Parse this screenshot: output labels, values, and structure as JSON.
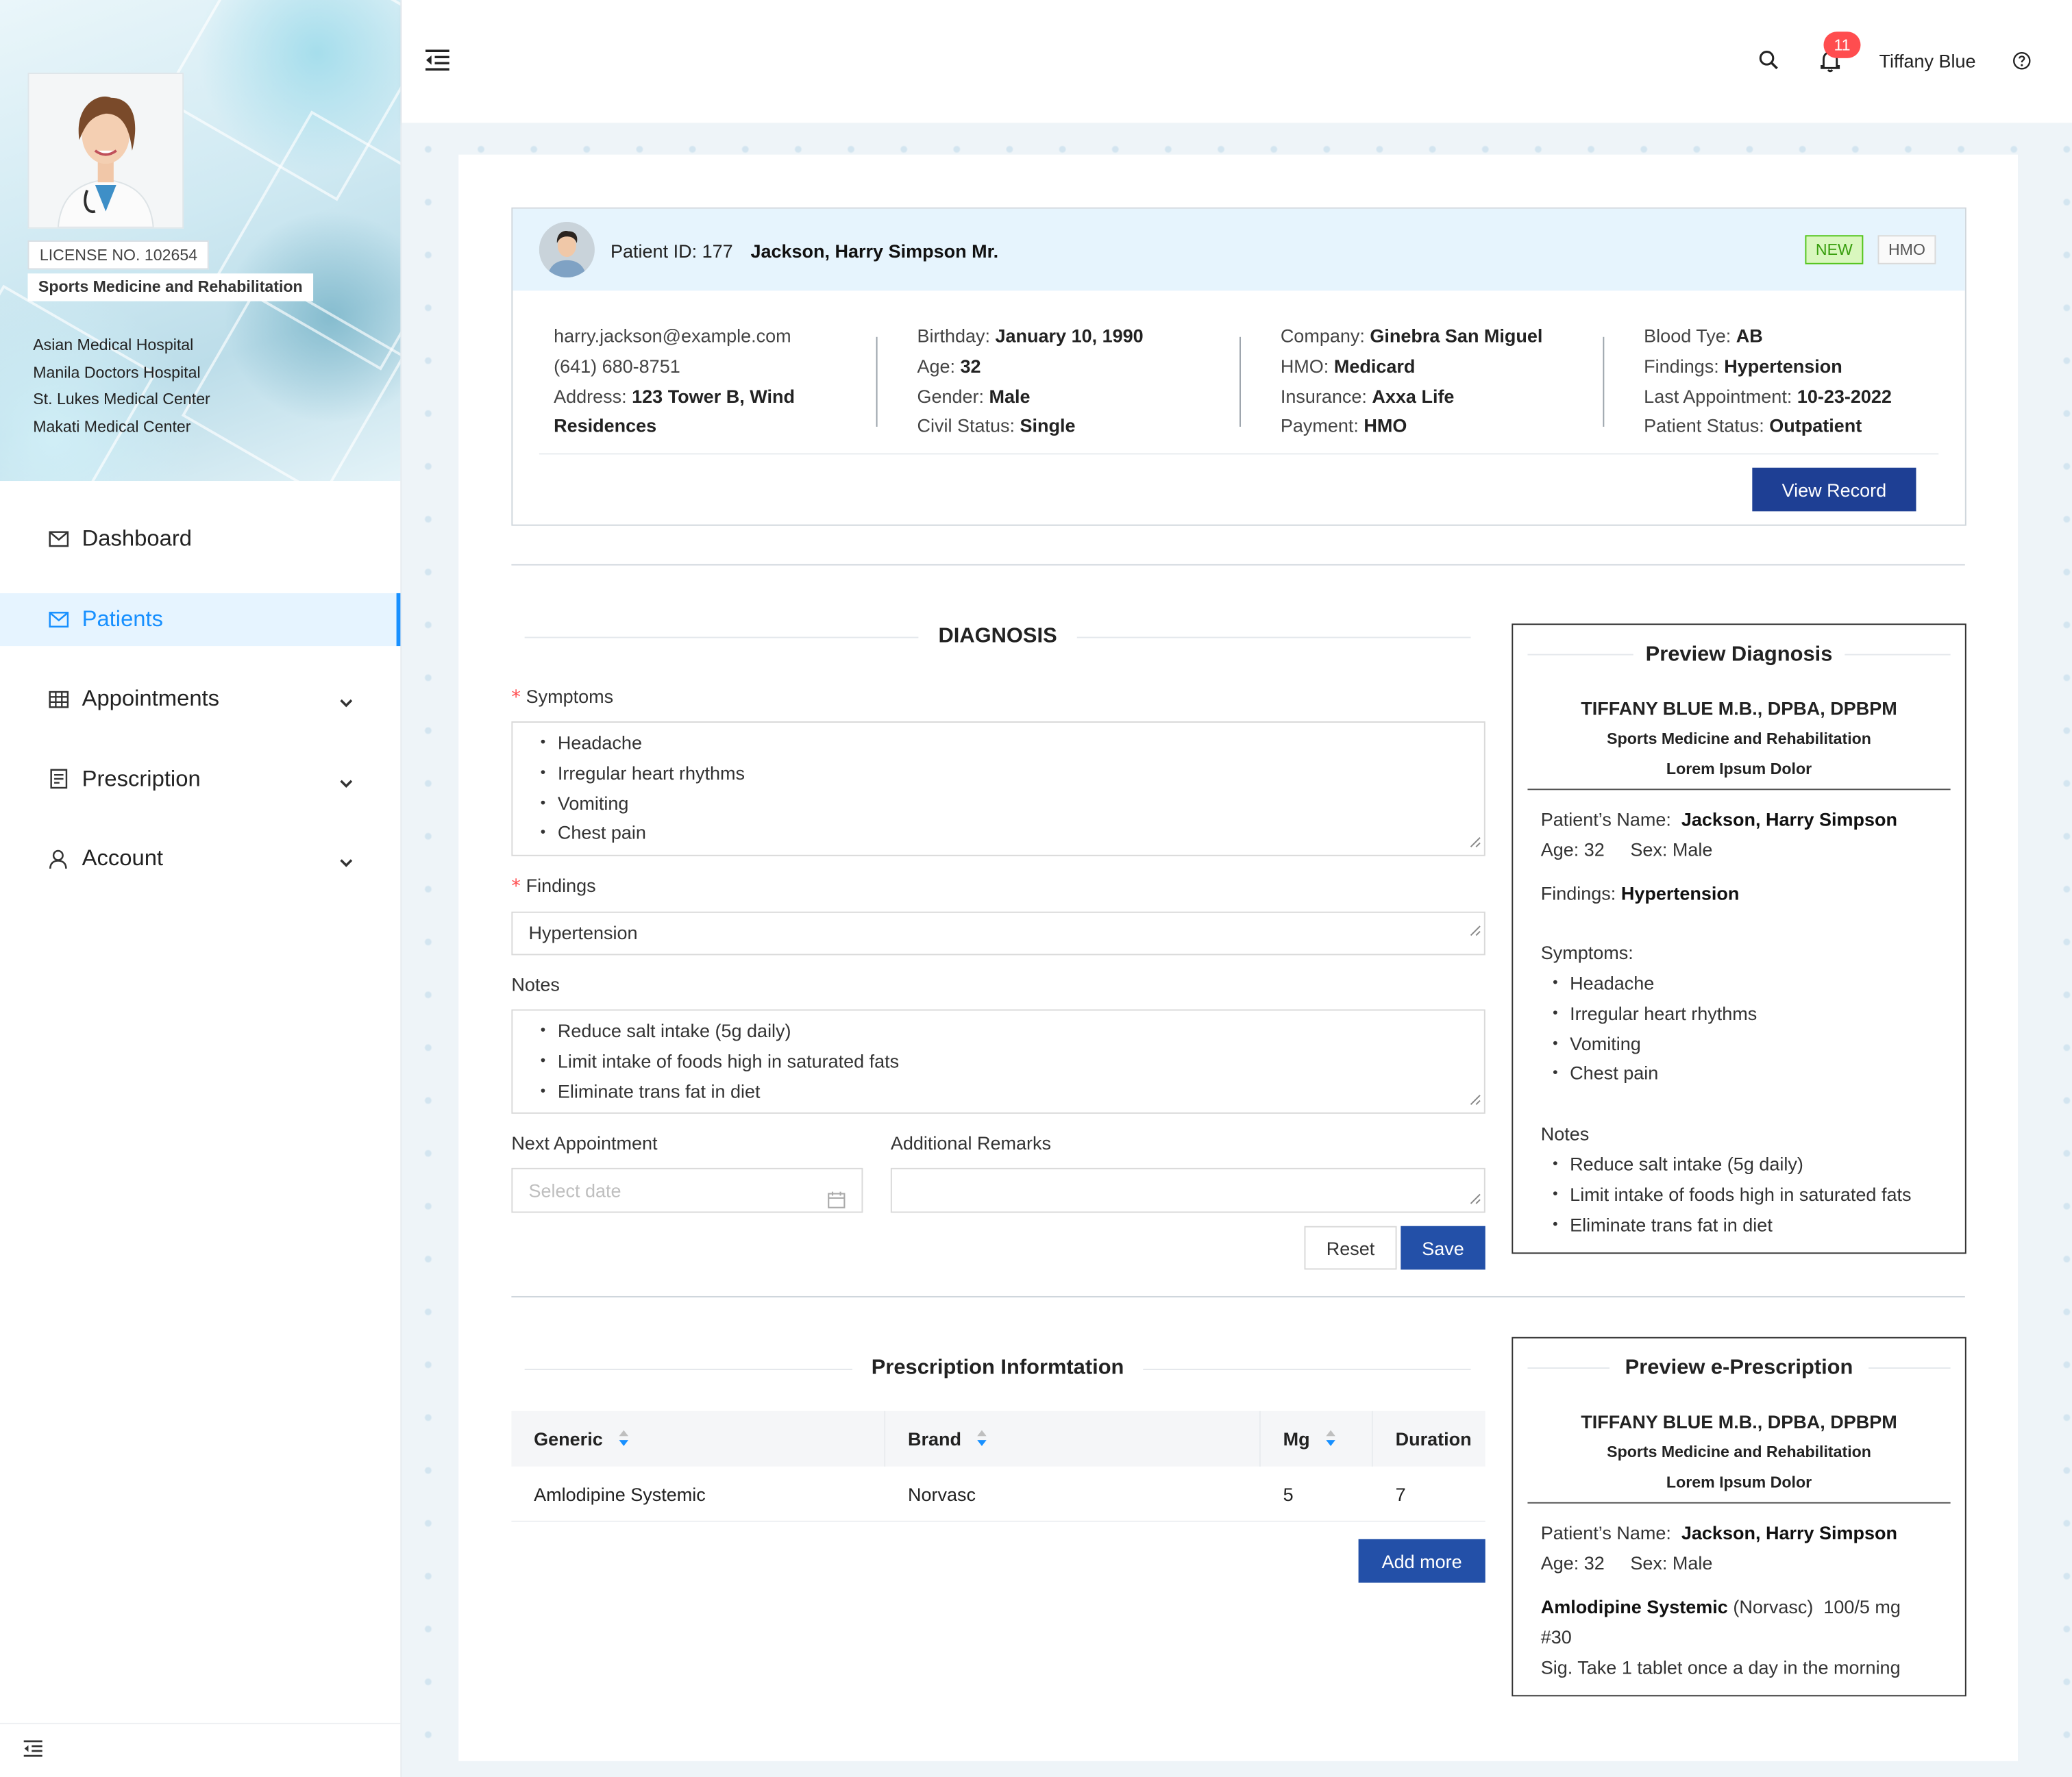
{
  "doctor": {
    "license": "LICENSE NO. 102654",
    "specialty": "Sports Medicine and Rehabilitation",
    "hospitals": [
      "Asian Medical Hospital",
      "Manila Doctors Hospital",
      "St. Lukes Medical Center",
      "Makati Medical Center"
    ]
  },
  "nav": {
    "items": [
      {
        "label": "Dashboard",
        "icon": "mail-icon"
      },
      {
        "label": "Patients",
        "icon": "mail-icon"
      },
      {
        "label": "Appointments",
        "icon": "table-icon"
      },
      {
        "label": "Prescription",
        "icon": "list-icon"
      },
      {
        "label": "Account",
        "icon": "user-icon"
      }
    ]
  },
  "header": {
    "notifications": "11",
    "user": "Tiffany Blue"
  },
  "patient": {
    "id_label": "Patient ID: 177",
    "name": "Jackson, Harry Simpson Mr.",
    "tags": [
      "NEW",
      "HMO"
    ],
    "email": "harry.jackson@example.com",
    "phone": "(641) 680-8751",
    "address_label": "Address:",
    "address_line1": "123 Tower B, Wind",
    "address_line2": "Residences",
    "birthday_label": "Birthday:",
    "birthday": "January 10, 1990",
    "age_label": "Age:",
    "age": "32",
    "gender_label": "Gender:",
    "gender": "Male",
    "civil_label": "Civil Status:",
    "civil": "Single",
    "company_label": "Company:",
    "company": "Ginebra San Miguel",
    "hmo_label": "HMO:",
    "hmo": "Medicard",
    "insurance_label": "Insurance:",
    "insurance": "Axxa Life",
    "payment_label": "Payment:",
    "payment": "HMO",
    "blood_label": "Blood Tye:",
    "blood": "AB",
    "findings_label": "Findings:",
    "findings": "Hypertension",
    "last_appt_label": "Last Appointment:",
    "last_appt": "10-23-2022",
    "status_label": "Patient Status:",
    "status": "Outpatient",
    "view_record": "View  Record"
  },
  "diagnosis": {
    "title": "DIAGNOSIS",
    "symptoms_label": "Symptoms",
    "symptoms": [
      "Headache",
      "Irregular heart rhythms",
      "Vomiting",
      "Chest pain"
    ],
    "findings_label": "Findings",
    "findings": "Hypertension",
    "notes_label": "Notes",
    "notes": [
      "Reduce salt intake (5g daily)",
      "Limit intake of foods high in saturated fats",
      "Eliminate trans fat in diet"
    ],
    "next_appt_label": "Next Appointment",
    "next_appt_placeholder": "Select date",
    "remarks_label": "Additional Remarks",
    "reset": "Reset",
    "save": "Save"
  },
  "preview_diagnosis": {
    "title": "Preview Diagnosis",
    "doctor": "TIFFANY BLUE M.B., DPBA, DPBPM",
    "specialty": "Sports Medicine and Rehabilitation",
    "sub": "Lorem Ipsum Dolor",
    "name_label": "Patient’s Name:",
    "name": "Jackson, Harry Simpson",
    "age": "Age: 32",
    "sex": "Sex: Male",
    "findings_label": "Findings:",
    "findings": "Hypertension",
    "symptoms_label": "Symptoms:",
    "symptoms": [
      "Headache",
      "Irregular heart rhythms",
      "Vomiting",
      "Chest pain"
    ],
    "notes_label": "Notes",
    "notes": [
      "Reduce salt intake (5g daily)",
      "Limit intake of foods high in saturated fats",
      "Eliminate trans fat in diet"
    ]
  },
  "prescription": {
    "title": "Prescription Informtation",
    "columns": [
      "Generic",
      "Brand",
      "Mg",
      "Duration"
    ],
    "rows": [
      {
        "generic": "Amlodipine Systemic",
        "brand": "Norvasc",
        "mg": "5",
        "duration": "7"
      }
    ],
    "add_more": "Add more"
  },
  "preview_rx": {
    "title": "Preview e-Prescription",
    "doctor": "TIFFANY BLUE M.B., DPBA, DPBPM",
    "specialty": "Sports Medicine and Rehabilitation",
    "sub": "Lorem Ipsum Dolor",
    "name_label": "Patient’s Name:",
    "name": "Jackson, Harry Simpson",
    "age": "Age: 32",
    "sex": "Sex: Male",
    "drug": "Amlodipine Systemic",
    "brand": "(Norvasc)",
    "dose": "100/5 mg",
    "qty": "#30",
    "sig": "Sig. Take 1 tablet once a day in the morning"
  },
  "colors": {
    "primary": "#1e3f94",
    "active": "#1890ff",
    "badge": "#ff4d4f",
    "new_tag": "#52c41a"
  }
}
